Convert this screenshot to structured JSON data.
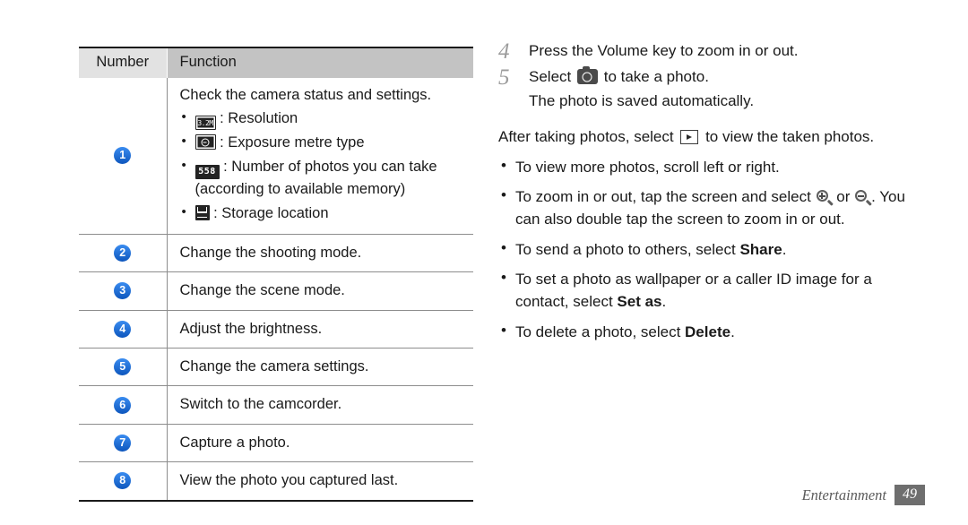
{
  "table": {
    "headers": {
      "number": "Number",
      "function": "Function"
    },
    "rows": [
      {
        "number": "1",
        "intro": "Check the camera status and settings.",
        "items": [
          {
            "icon": "resolution-icon",
            "icon_text": "3.2M",
            "text": ": Resolution"
          },
          {
            "icon": "exposure-metre-icon",
            "icon_text": "",
            "text": ": Exposure metre type"
          },
          {
            "icon": "photo-count-icon",
            "icon_text": "558",
            "text": ": Number of photos you can take"
          },
          {
            "icon": "",
            "icon_text": "",
            "text": "(according to available memory)"
          },
          {
            "icon": "storage-location-icon",
            "icon_text": "",
            "text": ": Storage location"
          }
        ]
      },
      {
        "number": "2",
        "text": "Change the shooting mode."
      },
      {
        "number": "3",
        "text": "Change the scene mode."
      },
      {
        "number": "4",
        "text": "Adjust the brightness."
      },
      {
        "number": "5",
        "text": "Change the camera settings."
      },
      {
        "number": "6",
        "text": "Switch to the camcorder."
      },
      {
        "number": "7",
        "text": "Capture a photo."
      },
      {
        "number": "8",
        "text": "View the photo you captured last."
      }
    ]
  },
  "instructions": {
    "steps": [
      {
        "num": "4",
        "text": "Press the Volume key to zoom in or out."
      },
      {
        "num": "5",
        "text_before": "Select",
        "icon": "camera-icon",
        "text_after": "to take a photo.",
        "subtext": "The photo is saved automatically."
      }
    ],
    "after_paragraph": {
      "before": "After taking photos, select",
      "icon": "play-view-icon",
      "after": "to view the taken photos."
    },
    "tips": [
      {
        "text": "To view more photos, scroll left or right."
      },
      {
        "text_1": "To zoom in or out, tap the screen and select",
        "icon_1": "zoom-in-icon",
        "text_2": "or",
        "icon_2": "zoom-out-icon",
        "text_3": ". You can also double tap the screen to zoom in or out."
      },
      {
        "text_1": "To send a photo to others, select",
        "bold": "Share",
        "text_3": "."
      },
      {
        "text_1": "To set a photo as wallpaper or a caller ID image for a contact, select",
        "bold": "Set as",
        "text_3": "."
      },
      {
        "text_1": "To delete a photo, select",
        "bold": "Delete",
        "text_3": "."
      }
    ]
  },
  "footer": {
    "chapter": "Entertainment",
    "page": "49"
  },
  "colors": {
    "badge_blue": "#1868d6",
    "header_number_bg": "#e2e2e2",
    "header_function_bg": "#c3c3c3",
    "page_box_bg": "#6e6e6e"
  }
}
